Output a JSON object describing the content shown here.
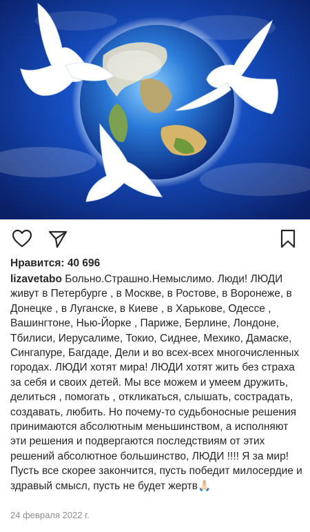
{
  "post": {
    "likes_text": "Нравится: 40 696",
    "username": "lizavetabo",
    "caption": "Больно.Страшно.Немыслимо. Люди! ЛЮДИ живут в Петербурге , в Москве, в Ростове, в Воронеже, в Донецке , в Луганске, в Киеве , в Харькове, Одессе , Вашингтоне, Нью-Йорке , Париже, Берлине, Лондоне, Тбилиси, Иерусалиме, Токио, Сиднее, Мехико, Дамаске, Сингапуре, Багдаде, Дели и во всех-всех многочисленных городах. ЛЮДИ хотят мира! ЛЮДИ хотят жить без страха за себя и своих детей. Мы все можем и умеем дружить, делиться , помогать , откликаться, слышать, сострадать, создавать, любить. Но почему-то судьбоносные решения принимаются абсолютным меньшинством, а исполняют эти решения и подвергаются последствиям от этих решений абсолютное большинство, ЛЮДИ !!!! Я за мир! Пусть все скорее закончится, пусть победит милосердие и здравый смысл, пусть не будет жертв🙏🏻",
    "date": "24 февраля 2022 г."
  },
  "icons": {
    "like": "heart-icon",
    "share": "send-icon",
    "save": "bookmark-icon"
  },
  "colors": {
    "text": "#262626",
    "muted": "#8e8e8e",
    "photo_blue": "#1646b8"
  }
}
